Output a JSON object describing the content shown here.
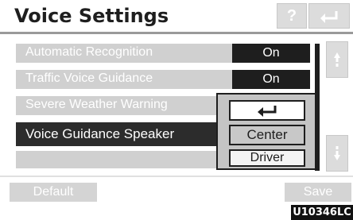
{
  "header": {
    "title": "Voice Settings",
    "help_label": "?"
  },
  "settings": [
    {
      "label": "Automatic Recognition",
      "value": "On"
    },
    {
      "label": "Traffic Voice Guidance",
      "value": "On"
    },
    {
      "label": "Severe Weather Warning",
      "value": ""
    },
    {
      "label": "Voice Guidance Speaker",
      "value": ""
    }
  ],
  "popup": {
    "options": [
      "Center",
      "Driver"
    ],
    "selected": "Center"
  },
  "footer": {
    "default_label": "Default",
    "save_label": "Save"
  },
  "image_code": "U10346LC",
  "icons": {
    "back": "return-arrow-icon",
    "scroll_up": "scroll-up-icon",
    "scroll_down": "scroll-down-icon"
  }
}
